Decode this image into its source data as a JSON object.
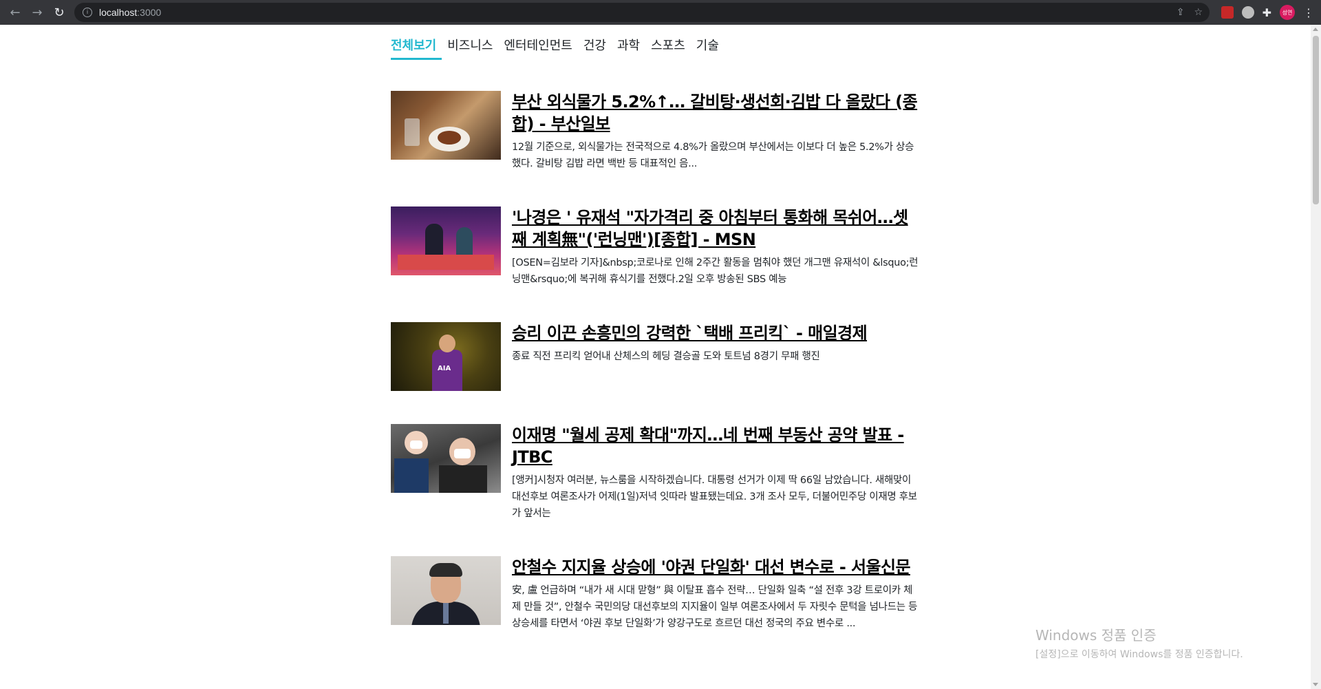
{
  "browser": {
    "url_host": "localhost",
    "url_port": ":3000",
    "back_icon": "arrow-left-icon",
    "forward_icon": "arrow-right-icon",
    "reload_icon": "reload-icon",
    "profile_initials": "성연"
  },
  "categories": [
    "전체보기",
    "비즈니스",
    "엔터테인먼트",
    "건강",
    "과학",
    "스포츠",
    "기술"
  ],
  "selected_category": "전체보기",
  "accent_color": "#22b8cf",
  "articles": [
    {
      "title": "부산 외식물가 5.2%↑… 갈비탕·생선회·김밥 다 올랐다 (종합) - 부산일보",
      "description": "12월 기준으로, 외식물가는 전국적으로 4.8%가 올랐으며 부산에서는 이보다 더 높은 5.2%가 상승했다. 갈비탕 김밥 라면 백반 등 대표적인 음..."
    },
    {
      "title": "'나경은 ' 유재석 \"자가격리 중 아침부터 통화해 목쉬어…셋째 계획無\"('런닝맨')[종합] - MSN",
      "description": "[OSEN=김보라 기자]&nbsp;코로나로 인해 2주간 활동을 멈춰야 했던 개그맨 유재석이 &lsquo;런닝맨&rsquo;에 복귀해 휴식기를 전했다.2일 오후 방송된 SBS 예능"
    },
    {
      "title": "승리 이끈 손흥민의 강력한 `택배 프리킥` - 매일경제",
      "description": "종료 직전 프리킥 얻어내 산체스의 헤딩 결승골 도와 토트넘 8경기 무패 행진"
    },
    {
      "title": "이재명 \"월세 공제 확대\"까지…네 번째 부동산 공약 발표 - JTBC",
      "description": "[앵커]시청자 여러분, 뉴스룸을 시작하겠습니다. 대통령 선거가 이제 딱 66일 남았습니다. 새해맞이 대선후보 여론조사가 어제(1일)저녁 잇따라 발표됐는데요. 3개 조사 모두, 더불어민주당 이재명 후보가 앞서는"
    },
    {
      "title": "안철수 지지율 상승에 '야권 단일화' 대선 변수로 - 서울신문",
      "description": "安, 盧 언급하며 “내가 새 시대 맏형” 與 이탈표 흡수 전략… 단일화 일축 “설 전후 3강 트로이카 체제 만들 것”, 안철수 국민의당 대선후보의 지지율이 일부 여론조사에서 두 자릿수 문턱을 넘나드는 등 상승세를 타면서 ‘야권 후보 단일화’가 양강구도로 흐르던 대선 정국의 주요 변수로 ..."
    }
  ],
  "watermark": {
    "line1": "Windows 정품 인증",
    "line2": "[설정]으로 이동하여 Windows를 정품 인증합니다."
  }
}
